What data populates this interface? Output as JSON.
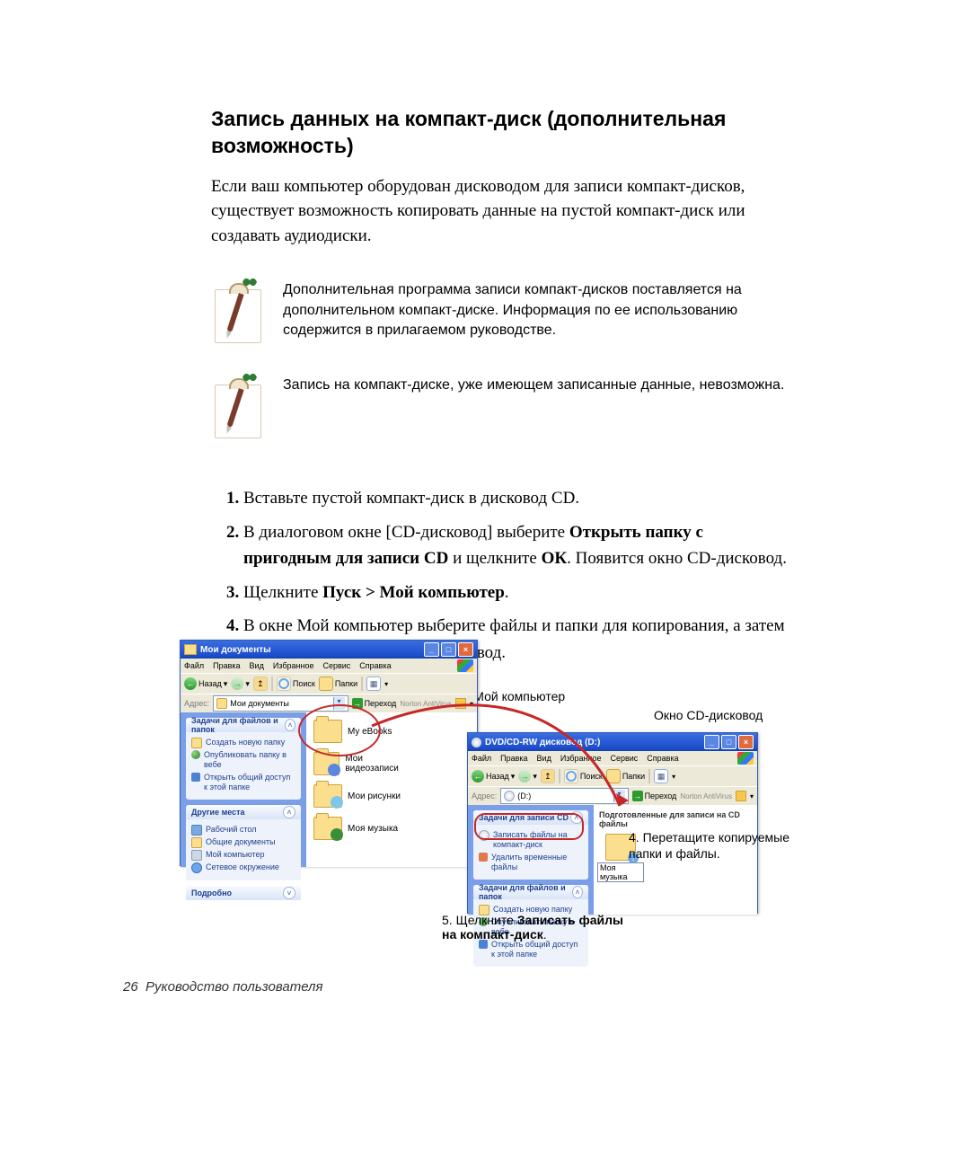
{
  "heading": "Запись данных на компакт-диск (дополнительная возможность)",
  "intro": "Если ваш компьютер оборудован дисководом для записи компакт-дисков, существует возможность копировать данные на пустой компакт-диск или создавать аудиодиски.",
  "note1": "Дополнительная программа записи компакт-дисков поставляется на дополнительном компакт-диске. Информация по ее использованию содержится в  прилагаемом руководстве.",
  "note2": "Запись на компакт-диске, уже имеющем записанные данные, невозможна.",
  "steps": {
    "s1": "Вставьте пустой компакт-диск в дисковод CD.",
    "s2a": "В диалоговом окне [CD-дисковод] выберите ",
    "s2b": "Открыть папку с пригодным для записи CD",
    "s2c": " и щелкните ",
    "s2d": "ОК",
    "s2e": ". Появится окно CD-дисковод.",
    "s3a": "Щелкните ",
    "s3b": "Пуск > Мой компьютер",
    "s3c": ".",
    "s4": "В окне Мой компьютер выберите файлы и папки для копирования, а затем перетащите их в окно CD-дисковод."
  },
  "caption_top": "Окно Мой компьютер",
  "caption_right": "Окно CD-дисковод",
  "callout4a": "4. Перетащите копируемые",
  "callout4b": "папки и файлы.",
  "callout5a": "5. Щелкните ",
  "callout5b": "Записать файлы на компакт-диск",
  "callout5c": ".",
  "page_footer_num": "26",
  "page_footer_txt": "Руководство пользователя",
  "win1": {
    "title": "Мои документы",
    "menu": {
      "file": "Файл",
      "edit": "Правка",
      "view": "Вид",
      "fav": "Избранное",
      "tools": "Сервис",
      "help": "Справка"
    },
    "tb": {
      "back": "Назад",
      "search": "Поиск",
      "folders": "Папки"
    },
    "addr": {
      "label": "Адрес:",
      "value": "Мои документы",
      "go": "Переход",
      "norton": "Norton AntiVirus"
    },
    "p1": {
      "title": "Задачи для файлов и папок",
      "i1": "Создать новую папку",
      "i2": "Опубликовать папку в вебе",
      "i3": "Открыть общий доступ к этой папке"
    },
    "p2": {
      "title": "Другие места",
      "i1": "Рабочий стол",
      "i2": "Общие документы",
      "i3": "Мой компьютер",
      "i4": "Сетевое окружение"
    },
    "p3": {
      "title": "Подробно"
    },
    "folders": {
      "f1": "My eBooks",
      "f2": "Мои видеозаписи",
      "f3": "Мои рисунки",
      "f4": "Моя музыка"
    }
  },
  "win2": {
    "title": "DVD/CD-RW дисковод (D:)",
    "menu": {
      "file": "Файл",
      "edit": "Правка",
      "view": "Вид",
      "fav": "Избранное",
      "tools": "Сервис",
      "help": "Справка"
    },
    "tb": {
      "back": "Назад",
      "search": "Поиск",
      "folders": "Папки"
    },
    "addr": {
      "label": "Адрес:",
      "value": "(D:)",
      "go": "Переход",
      "norton": "Norton AntiVirus"
    },
    "listhead": "Подготовленные для записи на CD файлы",
    "p1": {
      "title": "Задачи для записи CD",
      "i1": "Записать файлы на компакт-диск",
      "i2": "Удалить временные файлы"
    },
    "p2": {
      "title": "Задачи для файлов и папок",
      "i1": "Создать новую папку",
      "i2": "Опубликовать папку в вебе",
      "i3": "Открыть общий доступ к этой папке"
    },
    "fileLabel": "Моя музыка"
  }
}
